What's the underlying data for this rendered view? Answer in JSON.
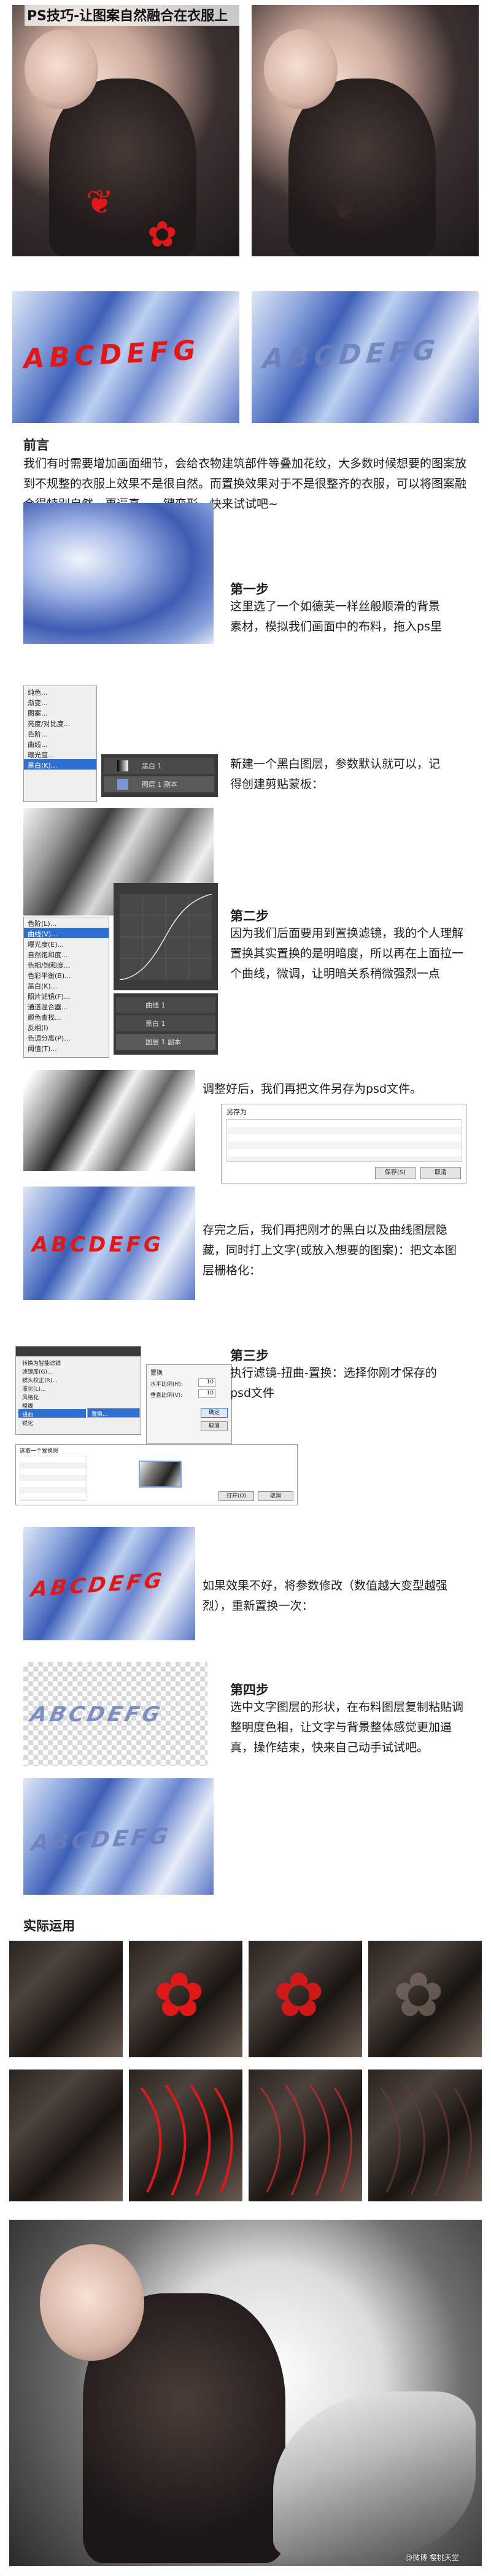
{
  "header": {
    "title": "PS技巧-让图案自然融合在衣服上"
  },
  "preface": {
    "heading": "前言",
    "body": "我们有时需要增加画面细节，会给衣物建筑部件等叠加花纹，大多数时候想要的图案放到不规整的衣服上效果不是很自然。而置换效果对于不是很整齐的衣服，可以将图案融合得特别自然，更逼真。一键变形，快来试试吧~"
  },
  "demo": {
    "letters": "ABCDEFG"
  },
  "steps": [
    {
      "label": "第一步",
      "text": "这里选了一个如德芙一样丝般顺滑的背景素材，模拟我们画面中的布料，拖入ps里"
    },
    {
      "label": "",
      "text": "新建一个黑白图层，参数默认就可以，记得创建剪贴蒙板："
    },
    {
      "label": "第二步",
      "text": "因为我们后面要用到置换滤镜，我的个人理解置换其实置换的是明暗度，所以再在上面拉一个曲线，微调，让明暗关系稍微强烈一点"
    },
    {
      "label": "",
      "text": "调整好后，我们再把文件另存为psd文件。"
    },
    {
      "label": "",
      "text": "存完之后，我们再把刚才的黑白以及曲线图层隐藏，同时打上文字(或放入想要的图案)：把文本图层栅格化："
    },
    {
      "label": "第三步",
      "text": "执行滤镜-扭曲-置换：选择你刚才保存的psd文件"
    },
    {
      "label": "",
      "text": "如果效果不好，将参数修改（数值越大变型越强烈），重新置换一次："
    },
    {
      "label": "第四步",
      "text": "选中文字图层的形状，在布料图层复制粘贴调整明度色相，让文字与背景整体感觉更加逼真，操作结束，快来自己动手试试吧。"
    }
  ],
  "application": {
    "heading": "实际运用"
  },
  "ps_ui": {
    "menu_items_1": [
      "色阶(L)...",
      "曲线(V)...",
      "曝光度(E)...",
      "自然饱和度...",
      "色相/饱和度...",
      "色彩平衡(B)...",
      "黑白(K)...",
      "照片滤镜(F)...",
      "通道混合器...",
      "颜色查找...",
      "反相(I)",
      "色调分离(P)...",
      "阈值(T)...",
      "渐变映射(M)...",
      "可选颜色(S)..."
    ],
    "menu_items_2": [
      "纯色...",
      "渐变...",
      "图案...",
      "亮度/对比度...",
      "色阶...",
      "曲线...",
      "曝光度..."
    ],
    "layer_1": "黑白 1",
    "layer_2": "图层 1 副本",
    "layer_3": "曲线 1",
    "filter_menu": [
      "转换为智能滤镜",
      "滤镜库(G)...",
      "自适应广角(A)...",
      "Camera Raw 滤镜(C)...",
      "镜头校正(R)...",
      "液化(L)...",
      "消失点(V)...",
      "3D",
      "风格化",
      "模糊",
      "扭曲",
      "锐化",
      "视频",
      "像素化",
      "渲染",
      "杂色",
      "其它"
    ],
    "distort_menu": [
      "波浪...",
      "波纹...",
      "极坐标...",
      "挤压...",
      "切变...",
      "球面化...",
      "水波...",
      "旋转扭曲...",
      "置换..."
    ],
    "displace_dialog": {
      "title": "置换",
      "h_label": "水平比例(H):",
      "h_value": "10",
      "v_label": "垂直比例(V):",
      "v_value": "10",
      "ok": "确定",
      "cancel": "取消"
    },
    "save_dialog": {
      "title": "另存为",
      "ok": "保存(S)",
      "cancel": "取消"
    },
    "open_dialog": {
      "title": "选取一个置换图",
      "ok": "打开(O)",
      "cancel": "取消"
    }
  },
  "watermark": "@微博 樱桃天堂"
}
